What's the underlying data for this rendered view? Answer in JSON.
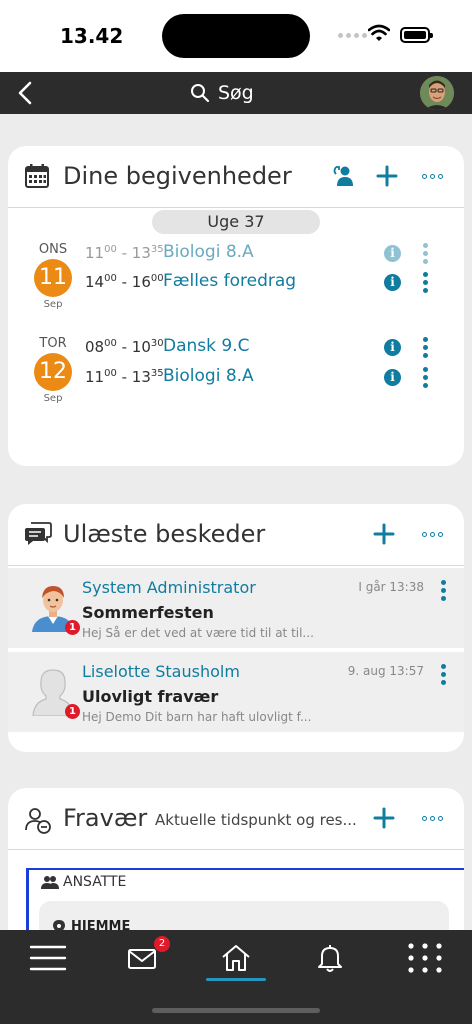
{
  "status_bar": {
    "time": "13.42"
  },
  "topnav": {
    "search_label": "Søg"
  },
  "events_card": {
    "title": "Dine begivenheder",
    "week": "Uge 37",
    "days": [
      {
        "weekday": "ONS",
        "day": "11",
        "month": "Sep",
        "events": [
          {
            "start_h": "11",
            "start_m": "00",
            "end_h": "13",
            "end_m": "35",
            "title": "Biologi 8.A",
            "faded": true
          },
          {
            "start_h": "14",
            "start_m": "00",
            "end_h": "16",
            "end_m": "00",
            "title": "Fælles foredrag",
            "faded": false
          }
        ]
      },
      {
        "weekday": "TOR",
        "day": "12",
        "month": "Sep",
        "events": [
          {
            "start_h": "08",
            "start_m": "00",
            "end_h": "10",
            "end_m": "30",
            "title": "Dansk 9.C",
            "faded": false
          },
          {
            "start_h": "11",
            "start_m": "00",
            "end_h": "13",
            "end_m": "35",
            "title": "Biologi 8.A",
            "faded": false
          }
        ]
      }
    ]
  },
  "messages_card": {
    "title": "Ulæste beskeder",
    "messages": [
      {
        "from": "System Administrator",
        "time": "I går 13:38",
        "subject": "Sommerfesten",
        "preview": "Hej Så er det ved at være tid til at til...",
        "unread": "1"
      },
      {
        "from": "Liselotte Stausholm",
        "time": "9. aug 13:57",
        "subject": "Ulovligt fravær",
        "preview": "Hej Demo Dit barn har haft ulovligt f...",
        "unread": "1"
      }
    ]
  },
  "absence_card": {
    "title": "Fravær",
    "subtitle": "Aktuelle tidspunkt og res...",
    "staff_label": "ANSATTE",
    "home_label": "HJEMME"
  },
  "bottom_nav": {
    "messages_badge": "2"
  },
  "colors": {
    "accent": "#0f7ca0",
    "day_badge": "#ec8a16",
    "badge_red": "#e11a2b",
    "nav_dark": "#2c2c2c"
  }
}
